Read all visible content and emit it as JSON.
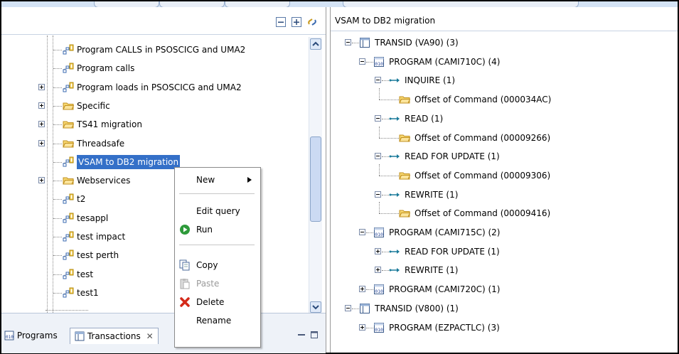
{
  "right_panel": {
    "title": "VSAM to DB2 migration",
    "tree": [
      {
        "label": "TRANSID (VA90)  (3)",
        "icon": "transaction-icon",
        "expanded": true,
        "level": 0
      },
      {
        "label": "PROGRAM (CAMI710C)  (4)",
        "icon": "program-icon",
        "expanded": true,
        "level": 1
      },
      {
        "label": "INQUIRE  (1)",
        "icon": "call-arrow-icon",
        "expanded": true,
        "level": 2
      },
      {
        "label": "Offset of Command (000034AC)",
        "icon": "folder-icon",
        "level": 3
      },
      {
        "label": "READ  (1)",
        "icon": "call-arrow-icon",
        "expanded": true,
        "level": 2
      },
      {
        "label": "Offset of Command (00009266)",
        "icon": "folder-icon",
        "level": 3
      },
      {
        "label": "READ FOR UPDATE  (1)",
        "icon": "call-arrow-icon",
        "expanded": true,
        "level": 2
      },
      {
        "label": "Offset of Command (00009306)",
        "icon": "folder-icon",
        "level": 3
      },
      {
        "label": "REWRITE  (1)",
        "icon": "call-arrow-icon",
        "expanded": true,
        "level": 2
      },
      {
        "label": "Offset of Command (00009416)",
        "icon": "folder-icon",
        "level": 3
      },
      {
        "label": "PROGRAM (CAMI715C)  (2)",
        "icon": "program-icon",
        "expanded": true,
        "level": 1
      },
      {
        "label": "READ FOR UPDATE  (1)",
        "icon": "call-arrow-icon",
        "expanded": false,
        "level": 2
      },
      {
        "label": "REWRITE  (1)",
        "icon": "call-arrow-icon",
        "expanded": false,
        "level": 2
      },
      {
        "label": "PROGRAM (CAMI720C)  (1)",
        "icon": "program-icon",
        "expanded": false,
        "level": 1
      },
      {
        "label": "TRANSID (V800)  (1)",
        "icon": "transaction-icon",
        "expanded": true,
        "level": 0
      },
      {
        "label": "PROGRAM (EZPACTLC)  (3)",
        "icon": "program-icon",
        "expanded": false,
        "level": 1
      }
    ]
  },
  "left_panel": {
    "tree": [
      {
        "label": "Program CALLS in PSOSCICG and UMA2",
        "icon": "query-icon"
      },
      {
        "label": "Program calls",
        "icon": "query-icon"
      },
      {
        "label": "Program loads in PSOSCICG and UMA2",
        "icon": "query-icon",
        "expander": "plus"
      },
      {
        "label": "Specific",
        "icon": "folder-icon",
        "expander": "plus"
      },
      {
        "label": "TS41 migration",
        "icon": "folder-icon",
        "expander": "plus"
      },
      {
        "label": "Threadsafe",
        "icon": "folder-icon",
        "expander": "plus"
      },
      {
        "label": "VSAM to DB2 migration",
        "icon": "query-icon",
        "selected": true
      },
      {
        "label": "Webservices",
        "icon": "folder-icon",
        "expander": "plus"
      },
      {
        "label": "t2",
        "icon": "query-icon"
      },
      {
        "label": "tesappl",
        "icon": "query-icon"
      },
      {
        "label": "test impact",
        "icon": "query-icon"
      },
      {
        "label": "test perth",
        "icon": "query-icon"
      },
      {
        "label": "test",
        "icon": "query-icon"
      },
      {
        "label": "test1",
        "icon": "query-icon"
      }
    ],
    "bottom_tabs": {
      "programs": "Programs",
      "transactions": "Transactions",
      "close_glyph": "✕"
    }
  },
  "context_menu": {
    "new": "New",
    "edit_query": "Edit query",
    "run": "Run",
    "copy": "Copy",
    "paste": "Paste",
    "delete": "Delete",
    "rename": "Rename"
  },
  "colors": {
    "selection": "#3470c8",
    "folder": "#f5c842",
    "arrow": "#1a7a9a"
  }
}
